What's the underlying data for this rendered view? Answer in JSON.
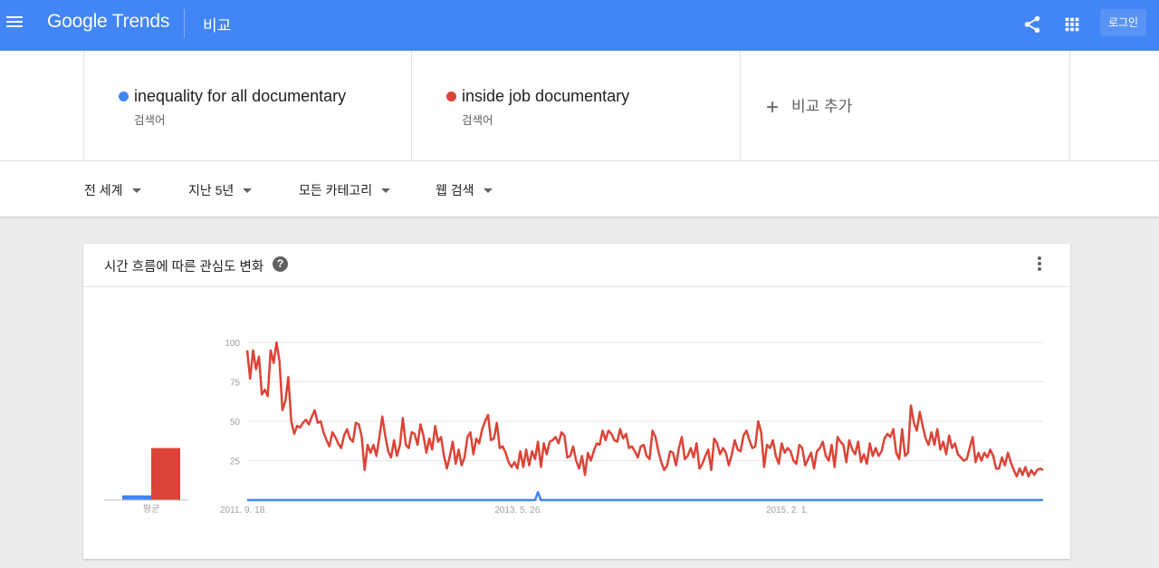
{
  "header": {
    "logo_google": "Google",
    "logo_trends": "Trends",
    "page_title": "비교",
    "login_label": "로그인",
    "icons": [
      "menu-icon",
      "share-icon",
      "apps-icon"
    ],
    "bg_color": "#4285f4"
  },
  "terms": [
    {
      "name": "inequality for all documentary",
      "type": "검색어",
      "color": "#4285f4"
    },
    {
      "name": "inside job documentary",
      "type": "검색어",
      "color": "#db4437"
    }
  ],
  "add_compare_label": "비교 추가",
  "filters": [
    {
      "label": "전 세계"
    },
    {
      "label": "지난 5년"
    },
    {
      "label": "모든 카테고리"
    },
    {
      "label": "웹 검색"
    }
  ],
  "card": {
    "title": "시간 흐름에 따른 관심도 변화",
    "help_symbol": "?"
  },
  "chart_data": {
    "type": "line",
    "yticks": [
      100,
      75,
      50,
      25
    ],
    "ylim": [
      0,
      100
    ],
    "xtick_labels": [
      "2011. 9. 18.",
      "2013. 5. 26.",
      "2015. 2. 1."
    ],
    "avg_label": "평균",
    "averages": [
      3,
      33
    ],
    "series": [
      {
        "name": "inequality for all documentary",
        "color": "#4285f4",
        "values": [
          0,
          0,
          0,
          0,
          0,
          0,
          0,
          0,
          0,
          0,
          0,
          0,
          0,
          0,
          0,
          0,
          0,
          0,
          0,
          0,
          0,
          0,
          0,
          0,
          0,
          0,
          0,
          0,
          0,
          0,
          0,
          0,
          0,
          0,
          0,
          0,
          0,
          0,
          0,
          0,
          0,
          0,
          0,
          0,
          0,
          0,
          0,
          0,
          0,
          0,
          0,
          0,
          0,
          0,
          0,
          0,
          0,
          0,
          0,
          0,
          0,
          0,
          0,
          0,
          0,
          0,
          0,
          0,
          0,
          0,
          0,
          0,
          0,
          0,
          0,
          0,
          0,
          0,
          0,
          0,
          0,
          0,
          0,
          0,
          0,
          0,
          0,
          0,
          0,
          0,
          0,
          0,
          0,
          0,
          0,
          0,
          0,
          0,
          0,
          5,
          0,
          0,
          0,
          0,
          0,
          0,
          0,
          0,
          0,
          0,
          0,
          0,
          0,
          0,
          0,
          0,
          0,
          0,
          0,
          0,
          0,
          0,
          0,
          0,
          0,
          0,
          0,
          0,
          0,
          0,
          0,
          0,
          0,
          0,
          0,
          0,
          0,
          0,
          0,
          0,
          0,
          0,
          0,
          0,
          0,
          0,
          0,
          0,
          0,
          0,
          0,
          0,
          0,
          0,
          0,
          0,
          0,
          0,
          0,
          0,
          0,
          0,
          0,
          0,
          0,
          0,
          0,
          0,
          0,
          0,
          0,
          0,
          0,
          0,
          0,
          0,
          0,
          0,
          0,
          0,
          0,
          0,
          0,
          0,
          0,
          0,
          0,
          0,
          0,
          0,
          0,
          0,
          0,
          0,
          0,
          0,
          0,
          0,
          0,
          0,
          0,
          0,
          0,
          0,
          0,
          0,
          0,
          0,
          0,
          0,
          0,
          0,
          0,
          0,
          0,
          0,
          0,
          0,
          0,
          0,
          0,
          0,
          0,
          0,
          0,
          0,
          0,
          0,
          0,
          0,
          0,
          0,
          0,
          0,
          0,
          0,
          0,
          0,
          0,
          0,
          0,
          0,
          0,
          0,
          0,
          0,
          0,
          0,
          0,
          0,
          0,
          0,
          0,
          0,
          0,
          0,
          0,
          0,
          0,
          0,
          0,
          0,
          0,
          0,
          0,
          0,
          0,
          0,
          0,
          0,
          0,
          0
        ]
      },
      {
        "name": "inside job documentary",
        "color": "#db4437",
        "values": [
          95,
          77,
          95,
          83,
          91,
          67,
          70,
          66,
          95,
          87,
          100,
          88,
          57,
          63,
          78,
          50,
          42,
          47,
          46,
          49,
          51,
          48,
          53,
          57,
          49,
          50,
          43,
          38,
          34,
          43,
          40,
          36,
          33,
          41,
          45,
          39,
          37,
          49,
          48,
          40,
          19,
          35,
          30,
          35,
          28,
          40,
          53,
          41,
          31,
          27,
          38,
          28,
          35,
          52,
          35,
          33,
          43,
          42,
          35,
          48,
          41,
          30,
          39,
          32,
          47,
          37,
          40,
          28,
          20,
          28,
          37,
          23,
          32,
          22,
          27,
          40,
          43,
          29,
          39,
          36,
          45,
          50,
          54,
          38,
          39,
          49,
          33,
          34,
          30,
          24,
          21,
          24,
          20,
          31,
          21,
          32,
          22,
          31,
          26,
          37,
          21,
          36,
          29,
          37,
          38,
          40,
          36,
          43,
          41,
          27,
          28,
          34,
          25,
          20,
          28,
          16,
          30,
          25,
          31,
          36,
          35,
          44,
          38,
          44,
          42,
          38,
          37,
          45,
          39,
          42,
          33,
          34,
          31,
          27,
          34,
          35,
          28,
          26,
          44,
          40,
          31,
          24,
          19,
          22,
          31,
          30,
          22,
          33,
          40,
          26,
          28,
          33,
          27,
          36,
          20,
          23,
          28,
          32,
          19,
          39,
          36,
          29,
          33,
          30,
          22,
          29,
          38,
          32,
          31,
          41,
          44,
          38,
          33,
          34,
          50,
          43,
          21,
          35,
          33,
          38,
          28,
          23,
          36,
          30,
          33,
          31,
          25,
          23,
          35,
          33,
          22,
          26,
          30,
          20,
          31,
          33,
          37,
          28,
          25,
          35,
          21,
          40,
          37,
          35,
          24,
          38,
          32,
          29,
          37,
          24,
          29,
          23,
          36,
          28,
          33,
          28,
          31,
          39,
          42,
          40,
          45,
          30,
          26,
          45,
          28,
          30,
          60,
          49,
          44,
          56,
          47,
          39,
          35,
          43,
          35,
          45,
          32,
          37,
          29,
          41,
          33,
          36,
          29,
          27,
          25,
          26,
          33,
          40,
          24,
          30,
          25,
          30,
          27,
          32,
          28,
          20,
          20,
          27,
          22,
          30,
          24,
          19,
          15,
          20,
          16,
          21,
          15,
          19,
          16,
          19,
          20,
          19
        ]
      }
    ]
  }
}
